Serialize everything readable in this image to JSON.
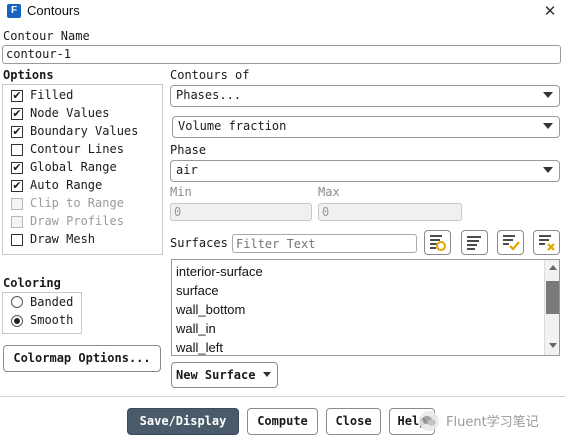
{
  "window": {
    "title": "Contours",
    "app_icon": "F",
    "close_glyph": "✕"
  },
  "contour_name": {
    "label": "Contour Name",
    "value": "contour-1"
  },
  "options": {
    "label": "Options",
    "items": [
      {
        "label": "Filled",
        "checked": true,
        "enabled": true
      },
      {
        "label": "Node Values",
        "checked": true,
        "enabled": true
      },
      {
        "label": "Boundary Values",
        "checked": true,
        "enabled": true
      },
      {
        "label": "Contour Lines",
        "checked": false,
        "enabled": true
      },
      {
        "label": "Global Range",
        "checked": true,
        "enabled": true
      },
      {
        "label": "Auto Range",
        "checked": true,
        "enabled": true
      },
      {
        "label": "Clip to Range",
        "checked": false,
        "enabled": false
      },
      {
        "label": "Draw Profiles",
        "checked": false,
        "enabled": false
      },
      {
        "label": "Draw Mesh",
        "checked": false,
        "enabled": true
      }
    ]
  },
  "contours_of": {
    "label": "Contours of",
    "category": "Phases...",
    "quantity": "Volume fraction"
  },
  "phase": {
    "label": "Phase",
    "value": "air"
  },
  "range": {
    "min_label": "Min",
    "min_value": "0",
    "max_label": "Max",
    "max_value": "0"
  },
  "surfaces": {
    "label": "Surfaces",
    "filter_placeholder": "Filter Text",
    "items": [
      "interior-surface",
      "surface",
      "wall_bottom",
      "wall_in",
      "wall_left"
    ],
    "tool_icons": [
      "select-all-icon",
      "list-icon",
      "check-list-icon",
      "deselect-icon"
    ]
  },
  "coloring": {
    "label": "Coloring",
    "options": [
      "Banded",
      "Smooth"
    ],
    "selected": "Smooth"
  },
  "colormap_button": "Colormap Options...",
  "new_surface_button": "New Surface",
  "buttons": {
    "save_display": "Save/Display",
    "compute": "Compute",
    "close": "Close",
    "help": "Help"
  },
  "watermark": "Fluent学习笔记",
  "colors": {
    "primary_button": "#4a5a6a",
    "app_icon": "#1565c0",
    "icon_accent": "#e6a400"
  }
}
